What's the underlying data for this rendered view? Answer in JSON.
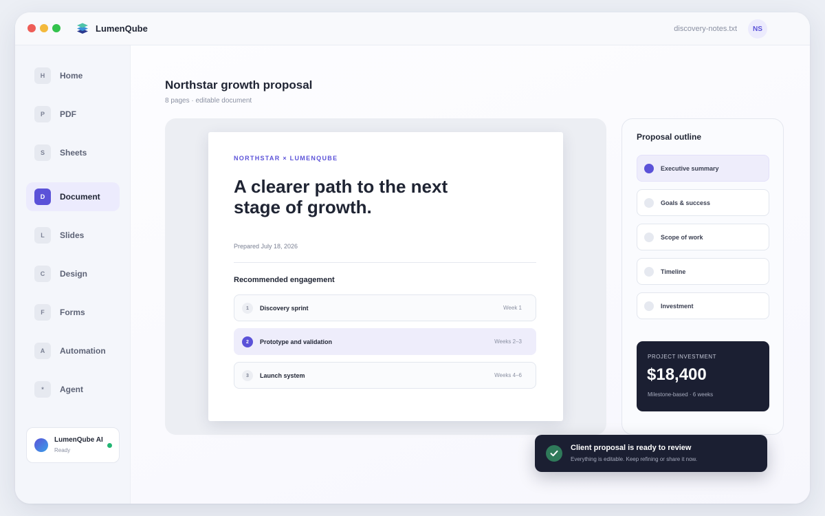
{
  "app": {
    "name": "LumenQube",
    "file_name": "discovery-notes.txt",
    "user_initials": "NS"
  },
  "sidebar": {
    "items": [
      {
        "badge": "H",
        "label": "Home"
      },
      {
        "badge": "P",
        "label": "PDF"
      },
      {
        "badge": "S",
        "label": "Sheets"
      },
      {
        "badge": "D",
        "label": "Document",
        "active": true
      },
      {
        "badge": "L",
        "label": "Slides"
      },
      {
        "badge": "C",
        "label": "Design"
      },
      {
        "badge": "F",
        "label": "Forms"
      },
      {
        "badge": "A",
        "label": "Automation"
      },
      {
        "badge": "*",
        "label": "Agent"
      }
    ],
    "assistant": {
      "name": "LumenQube AI",
      "status": "Ready"
    }
  },
  "document": {
    "title": "Northstar growth proposal",
    "subtitle": "8 pages · editable document",
    "page": {
      "eyebrow": "NORTHSTAR × LUMENQUBE",
      "headline": "A clearer path to the next stage of growth.",
      "prepared": "Prepared July 18, 2026",
      "engagement_title": "Recommended engagement",
      "steps": [
        {
          "num": "1",
          "label": "Discovery sprint",
          "duration": "Week 1"
        },
        {
          "num": "2",
          "label": "Prototype and validation",
          "duration": "Weeks 2–3",
          "active": true
        },
        {
          "num": "3",
          "label": "Launch system",
          "duration": "Weeks 4–6"
        }
      ]
    }
  },
  "outline": {
    "title": "Proposal outline",
    "items": [
      {
        "label": "Executive summary",
        "active": true
      },
      {
        "label": "Goals & success"
      },
      {
        "label": "Scope of work"
      },
      {
        "label": "Timeline"
      },
      {
        "label": "Investment"
      }
    ],
    "investment": {
      "label": "PROJECT INVESTMENT",
      "value": "$18,400",
      "note": "Milestone-based · 6 weeks"
    }
  },
  "toast": {
    "title": "Client proposal is ready to review",
    "message": "Everything is editable. Keep refining or share it now."
  },
  "colors": {
    "accent": "#5b52d8",
    "dark": "#1b1f32",
    "success": "#22b573"
  },
  "icons": {
    "logo": "layers-icon",
    "toast": "check-circle-icon"
  }
}
